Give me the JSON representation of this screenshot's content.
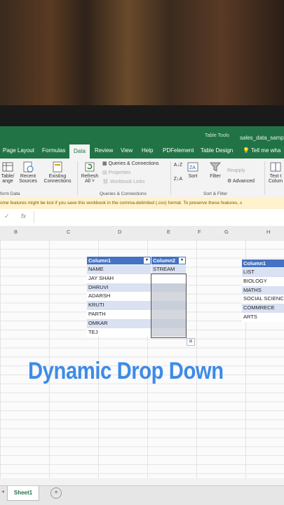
{
  "tabs": {
    "items": [
      "Page Layout",
      "Formulas",
      "Data",
      "Review",
      "View",
      "Help",
      "PDFelement",
      "Table Design"
    ],
    "active": "Data",
    "context_label": "Table Tools",
    "file_name": "sales_data_sample",
    "tell_me": "Tell me wha"
  },
  "ribbon": {
    "table_range": "Table/ ange",
    "recent_sources": "Recent Sources",
    "existing_connections": "Existing Connections",
    "refresh_all": "Refresh All ˅",
    "queries_connections": "Queries & Connections",
    "properties": "Properties",
    "workbook_links": "Workbook Links",
    "group_queries": "Queries & Connections",
    "group_transform": "form Data",
    "sort_label": "Sort",
    "filter_label": "Filter",
    "reapply": "Reapply",
    "advanced": "Advanced",
    "group_sort": "Sort & Filter",
    "text_to_columns": "Text t Colum"
  },
  "warning": "ome features might be lost if you save this workbook in the comma-delimited (.csv) format. To preserve these features, s",
  "formula_bar": {
    "fx": "fx"
  },
  "columns": [
    "B",
    "C",
    "D",
    "E",
    "F",
    "G",
    "H"
  ],
  "table1": {
    "col1": "Column1",
    "col2": "Column2",
    "rows": [
      {
        "c1": "NAME",
        "c2": "STREAM"
      },
      {
        "c1": "JAY SHAH",
        "c2": ""
      },
      {
        "c1": "DHRUVI",
        "c2": ""
      },
      {
        "c1": "ADARSH",
        "c2": ""
      },
      {
        "c1": "KRUTI",
        "c2": ""
      },
      {
        "c1": "PARTH",
        "c2": ""
      },
      {
        "c1": "OMKAR",
        "c2": ""
      },
      {
        "c1": "TEJ",
        "c2": ""
      }
    ]
  },
  "table2": {
    "col1": "Column1",
    "rows": [
      "LIST",
      "BIOLOGY",
      "MATHS",
      "SOCIAL SCIENC",
      "COMMRECE",
      "ARTS"
    ]
  },
  "overlay_title": "Dynamic Drop Down",
  "sheet_tab": "Sheet1",
  "accent": "#217346",
  "table_header_color": "#4472c4",
  "overlay_color": "#3d8be8"
}
